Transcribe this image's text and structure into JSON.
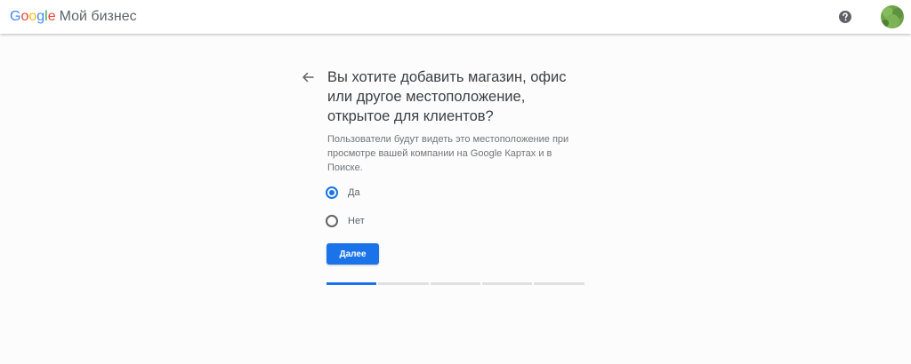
{
  "header": {
    "brand_letters": [
      "G",
      "o",
      "o",
      "g",
      "l",
      "e"
    ],
    "product_name": "Мой бизнес",
    "help_icon": "help-circle-icon",
    "avatar_icon": "user-avatar"
  },
  "main": {
    "back_icon": "arrow-back-icon",
    "title_lines": [
      "Вы хотите добавить магазин, офис",
      "или другое местоположение,",
      "открытое для клиентов?"
    ],
    "subtitle_lines": [
      "Пользователи будут видеть это местоположение при",
      "просмотре вашей компании на Google Картах и в",
      "Поиске."
    ],
    "options": [
      {
        "label": "Да",
        "selected": true
      },
      {
        "label": "Нет",
        "selected": false
      }
    ],
    "next_button_label": "Далее",
    "progress": {
      "current_step": 1,
      "total_steps": 5
    }
  },
  "colors": {
    "accent": "#1a73e8",
    "progress_inactive": "#e0e0e0",
    "text_primary": "#3c4043",
    "text_secondary": "#70757a"
  }
}
